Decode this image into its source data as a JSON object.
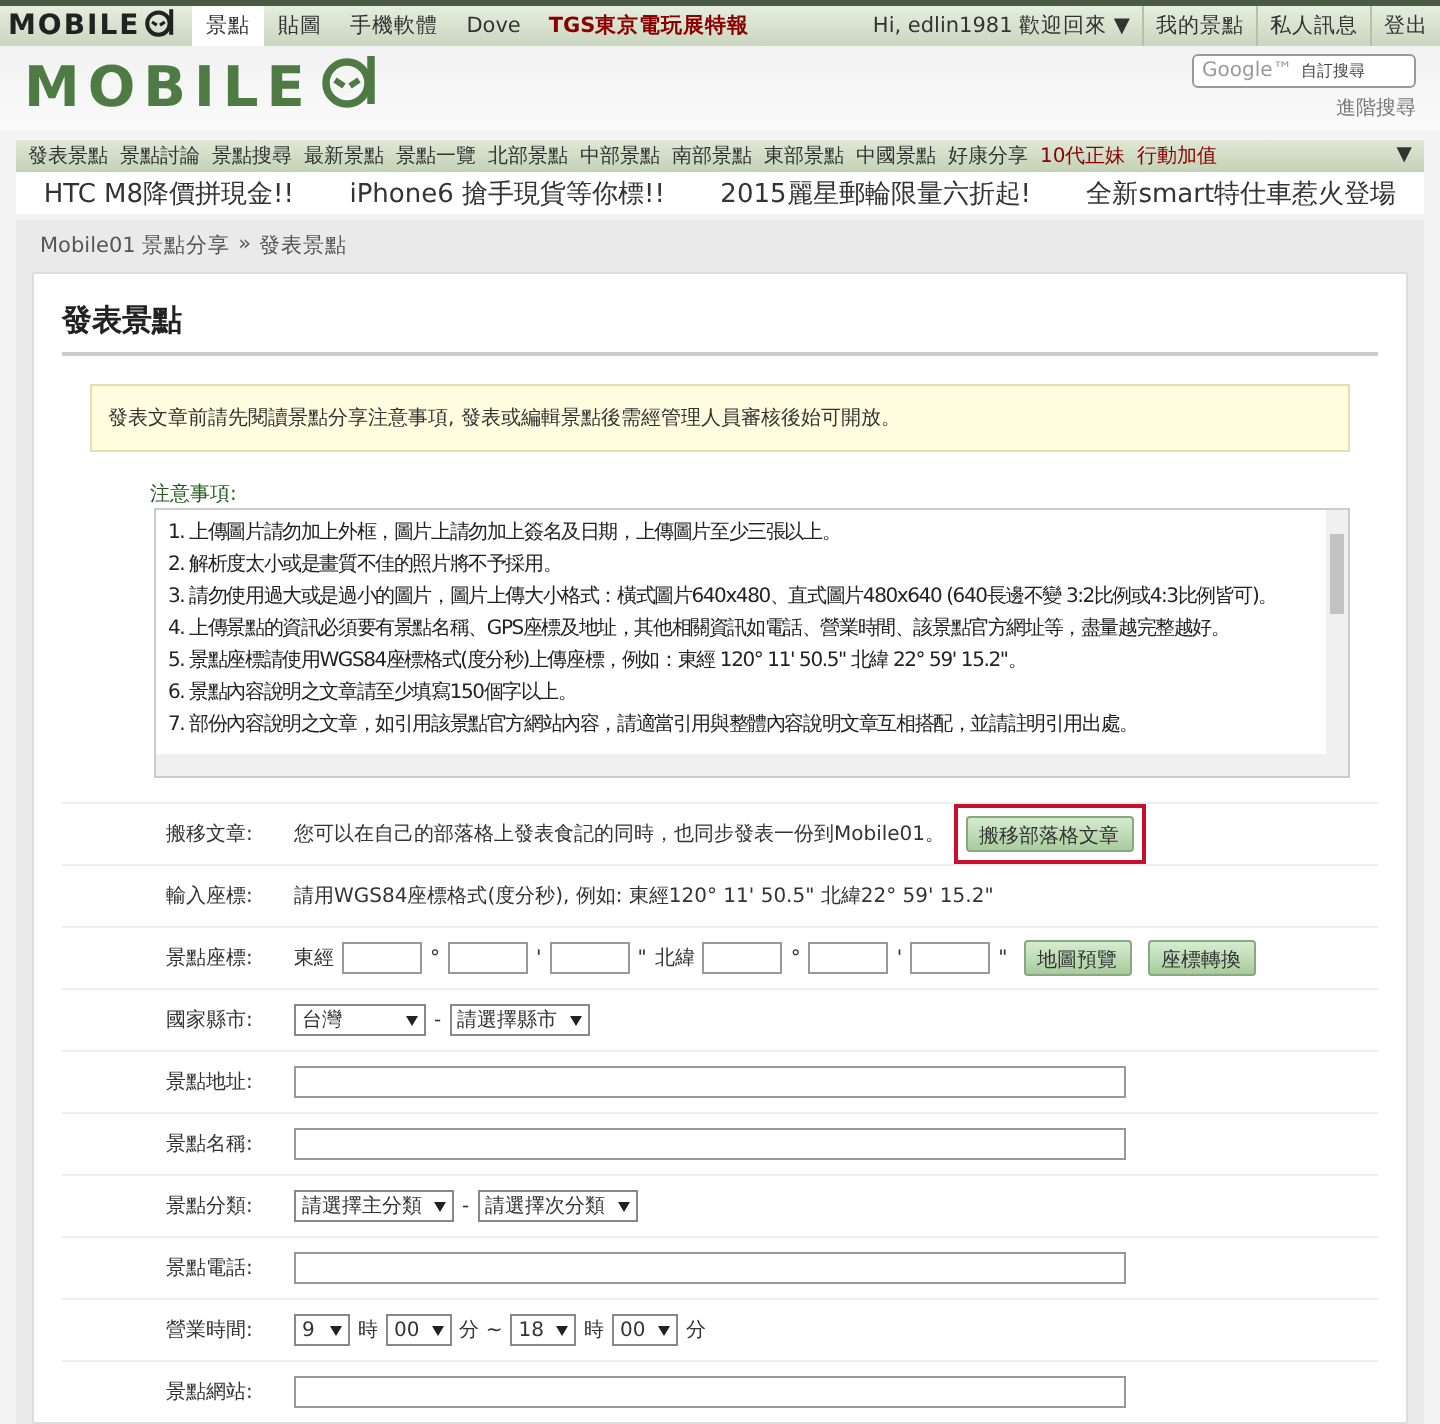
{
  "top_bar": {
    "logo": "MOBILE",
    "tabs": [
      {
        "label": "景點",
        "selected": true,
        "color": "#333333"
      },
      {
        "label": "貼圖",
        "selected": false,
        "color": "#333333"
      },
      {
        "label": "手機軟體",
        "selected": false,
        "color": "#333333"
      },
      {
        "label": "Dove",
        "selected": false,
        "color": "#333333"
      },
      {
        "label": "TGS東京電玩展特報",
        "selected": false,
        "color": "#8b0000"
      }
    ],
    "user": "Hi, edlin1981 歡迎回來 ▼",
    "links": [
      "我的景點",
      "私人訊息",
      "登出"
    ]
  },
  "header": {
    "logo": "MOBILE",
    "search_placeholder": "自訂搜尋",
    "search_brand": "Google™",
    "advanced": "進階搜尋"
  },
  "nav": {
    "items": [
      {
        "label": "發表景點",
        "color": "#333333"
      },
      {
        "label": "景點討論",
        "color": "#333333"
      },
      {
        "label": "景點搜尋",
        "color": "#333333"
      },
      {
        "label": "最新景點",
        "color": "#333333"
      },
      {
        "label": "景點一覽",
        "color": "#333333"
      },
      {
        "label": "北部景點",
        "color": "#333333"
      },
      {
        "label": "中部景點",
        "color": "#333333"
      },
      {
        "label": "南部景點",
        "color": "#333333"
      },
      {
        "label": "東部景點",
        "color": "#333333"
      },
      {
        "label": "中國景點",
        "color": "#333333"
      },
      {
        "label": "好康分享",
        "color": "#333333"
      },
      {
        "label": "10代正妹",
        "color": "#8b0000"
      },
      {
        "label": "行動加值",
        "color": "#8b0000"
      }
    ],
    "toggle": "▼"
  },
  "ads": [
    "HTC M8降價拼現金!!",
    "iPhone6 搶手現貨等你標!!",
    "2015麗星郵輪限量六折起!",
    "全新smart特仕車惹火登場"
  ],
  "breadcrumb": [
    "Mobile01 景點分享",
    "»",
    "發表景點"
  ],
  "page_title": "發表景點",
  "notice": "發表文章前請先閱讀景點分享注意事項, 發表或編輯景點後需經管理人員審核後始可開放。",
  "notes": {
    "label": "注意事項:",
    "lines": [
      "1. 上傳圖片請勿加上外框，圖片上請勿加上簽名及日期，上傳圖片至少三張以上。",
      "2. 解析度太小或是畫質不佳的照片將不予採用。",
      "3. 請勿使用過大或是過小的圖片，圖片上傳大小格式：橫式圖片640x480、直式圖片480x640 (640長邊不變 3:2比例或4:3比例皆可)。",
      "4. 上傳景點的資訊必須要有景點名稱、GPS座標及地址，其他相關資訊如電話、營業時間、該景點官方網址等，盡量越完整越好。",
      "5. 景點座標請使用WGS84座標格式(度分秒)上傳座標，例如：東經 120° 11' 50.5\" 北緯 22° 59' 15.2\"。",
      "6. 景點內容說明之文章請至少填寫150個字以上。",
      "7. 部份內容說明之文章，如引用該景點官方網站內容，請適當引用與整體內容說明文章互相搭配，並請註明引用出處。"
    ]
  },
  "form": [
    {
      "kind": "import",
      "label": "搬移文章:",
      "text": "您可以在自己的部落格上發表食記的同時，也同步發表一份到Mobile01。",
      "button": "搬移部落格文章",
      "highlighted": true
    },
    {
      "kind": "info",
      "label": "輸入座標:",
      "text": "請用WGS84座標格式(度分秒), 例如: 東經120° 11' 50.5\" 北緯22° 59' 15.2\""
    },
    {
      "kind": "coords",
      "label": "景點座標:",
      "groups": [
        {
          "label": "東經",
          "units": [
            "°",
            "'",
            "\""
          ]
        },
        {
          "label": "北緯",
          "units": [
            "°",
            "'",
            "\""
          ]
        }
      ],
      "buttons": [
        "地圖預覽",
        "座標轉換"
      ]
    },
    {
      "kind": "selects",
      "label": "國家縣市:",
      "selects": [
        "台灣",
        "請選擇縣市"
      ],
      "separator": "-"
    },
    {
      "kind": "input",
      "label": "景點地址:"
    },
    {
      "kind": "input",
      "label": "景點名稱:"
    },
    {
      "kind": "selects",
      "label": "景點分類:",
      "selects": [
        "請選擇主分類",
        "請選擇次分類"
      ],
      "separator": "-"
    },
    {
      "kind": "input",
      "label": "景點電話:"
    },
    {
      "kind": "hours",
      "label": "營業時間:",
      "parts": [
        {
          "kind": "select",
          "value": "9"
        },
        {
          "kind": "text",
          "value": "時"
        },
        {
          "kind": "select",
          "value": "00"
        },
        {
          "kind": "text",
          "value": "分 ~"
        },
        {
          "kind": "select",
          "value": "18"
        },
        {
          "kind": "text",
          "value": "時"
        },
        {
          "kind": "select",
          "value": "00"
        },
        {
          "kind": "text",
          "value": "分"
        }
      ]
    },
    {
      "kind": "input",
      "label": "景點網站:"
    }
  ]
}
